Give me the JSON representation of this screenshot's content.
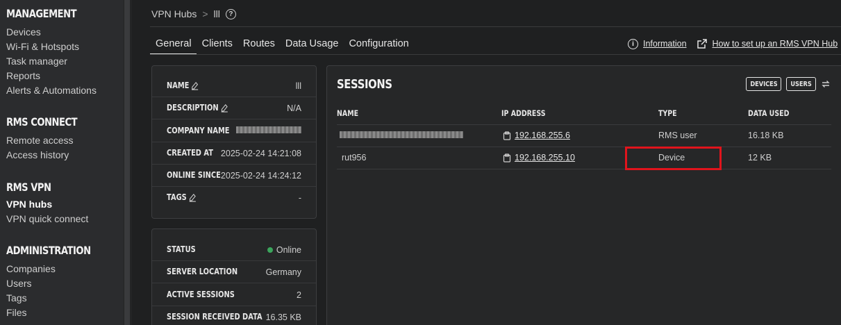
{
  "sidebar": {
    "sections": [
      {
        "title": "MANAGEMENT",
        "items": [
          "Devices",
          "Wi-Fi & Hotspots",
          "Task manager",
          "Reports",
          "Alerts & Automations"
        ]
      },
      {
        "title": "RMS CONNECT",
        "items": [
          "Remote access",
          "Access history"
        ]
      },
      {
        "title": "RMS VPN",
        "items": [
          "VPN hubs",
          "VPN quick connect"
        ],
        "active": "VPN hubs"
      },
      {
        "title": "ADMINISTRATION",
        "items": [
          "Companies",
          "Users",
          "Tags",
          "Files"
        ]
      }
    ]
  },
  "breadcrumb": {
    "root": "VPN Hubs",
    "separator": ">",
    "current": "lll",
    "help": "?"
  },
  "tabs": [
    "General",
    "Clients",
    "Routes",
    "Data Usage",
    "Configuration"
  ],
  "active_tab": "General",
  "help_links": {
    "info_icon": "i",
    "information": "Information",
    "setup": "How to set up an RMS VPN Hub"
  },
  "details_card": {
    "name": {
      "label": "NAME",
      "value": "lll"
    },
    "description": {
      "label": "DESCRIPTION",
      "value": "N/A"
    },
    "company": {
      "label": "COMPANY NAME"
    },
    "created": {
      "label": "CREATED AT",
      "value": "2025-02-24 14:21:08"
    },
    "online": {
      "label": "ONLINE SINCE",
      "value": "2025-02-24 14:24:12"
    },
    "tags": {
      "label": "TAGS",
      "value": "-"
    }
  },
  "status_card": {
    "status": {
      "label": "STATUS",
      "value": "Online"
    },
    "location": {
      "label": "SERVER LOCATION",
      "value": "Germany"
    },
    "sessions": {
      "label": "ACTIVE SESSIONS",
      "value": "2"
    },
    "received": {
      "label": "SESSION RECEIVED DATA",
      "value": "16.35 KB"
    }
  },
  "sessions": {
    "title": "SESSIONS",
    "btn_devices": "DEVICES",
    "btn_users": "USERS",
    "headers": {
      "name": "NAME",
      "ip": "IP ADDRESS",
      "type": "TYPE",
      "data": "DATA USED"
    },
    "rows": [
      {
        "ip": "192.168.255.6",
        "type": "RMS user",
        "data": "16.18 KB"
      },
      {
        "name": "rut956",
        "ip": "192.168.255.10",
        "type": "Device",
        "data": "12 KB"
      }
    ]
  },
  "colors": {
    "online": "#3ba55c",
    "highlight": "#e0141c"
  }
}
